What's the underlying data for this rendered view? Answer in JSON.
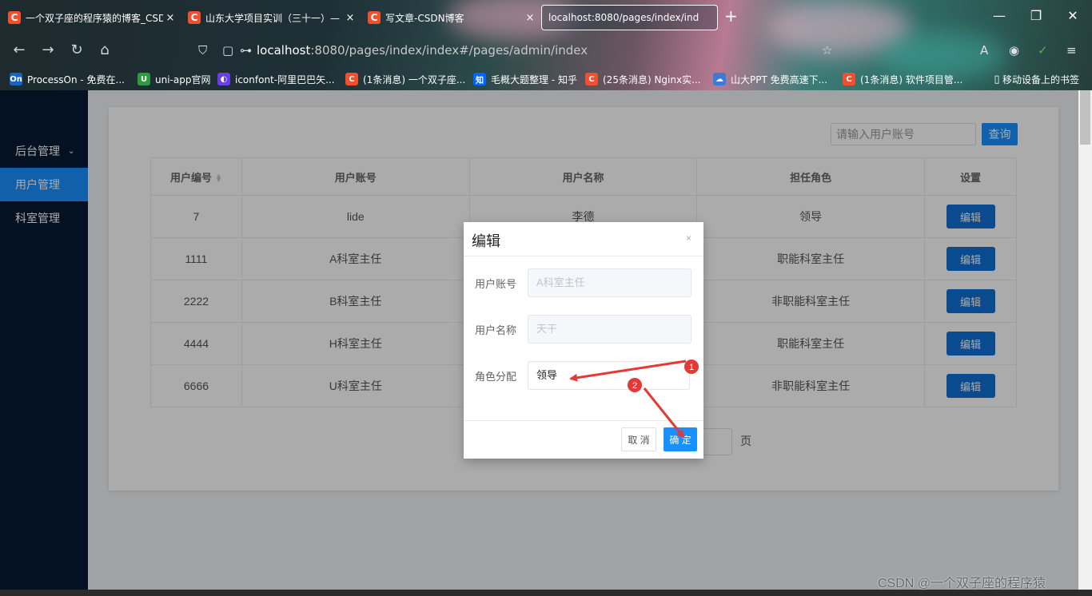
{
  "browser": {
    "tabs": [
      {
        "title": "一个双子座的程序猿的博客_CSD",
        "favicon": "C"
      },
      {
        "title": "山东大学项目实训（三十一）—",
        "favicon": "C"
      },
      {
        "title": "写文章-CSDN博客",
        "favicon": "C"
      },
      {
        "title": "localhost:8080/pages/index/ind"
      }
    ],
    "close_glyph": "×",
    "new_tab": "+",
    "url_host": "localhost",
    "url_rest": ":8080/pages/index/index#/pages/admin/index",
    "bookmarks": [
      {
        "label": "ProcessOn - 免费在...",
        "icon": "On",
        "color": "#1565c0"
      },
      {
        "label": "uni-app官网",
        "icon": "U",
        "color": "#2e9c3e"
      },
      {
        "label": "iconfont-阿里巴巴矢...",
        "icon": "◐",
        "color": "#6a3de8"
      },
      {
        "label": "(1条消息) 一个双子座...",
        "icon": "C",
        "color": "#f1502f"
      },
      {
        "label": "毛概大题整理 - 知乎",
        "icon": "知",
        "color": "#0066ff"
      },
      {
        "label": "(25条消息) Nginx实...",
        "icon": "C",
        "color": "#f1502f"
      },
      {
        "label": "山大PPT 免费高速下...",
        "icon": "☁",
        "color": "#3a7bd5"
      },
      {
        "label": "(1条消息) 软件项目管...",
        "icon": "C",
        "color": "#f1502f"
      },
      {
        "label": "移动设备上的书签",
        "icon": "▯",
        "color": "transparent"
      }
    ]
  },
  "sidebar": {
    "group_label": "后台管理",
    "items": [
      "用户管理",
      "科室管理"
    ]
  },
  "search": {
    "placeholder": "请输入用户账号",
    "button_label": "查询"
  },
  "table": {
    "headers": [
      "用户编号",
      "用户账号",
      "用户名称",
      "担任角色",
      "设置"
    ],
    "rows": [
      {
        "id": "7",
        "account": "lide",
        "name": "李德",
        "role": "领导"
      },
      {
        "id": "1111",
        "account": "A科室主任",
        "name": "",
        "role": "职能科室主任"
      },
      {
        "id": "2222",
        "account": "B科室主任",
        "name": "",
        "role": "非职能科室主任"
      },
      {
        "id": "4444",
        "account": "H科室主任",
        "name": "",
        "role": "职能科室主任"
      },
      {
        "id": "6666",
        "account": "U科室主任",
        "name": "",
        "role": "非职能科室主任"
      }
    ],
    "edit_label": "编辑"
  },
  "pagination": {
    "unit": "页"
  },
  "modal": {
    "title": "编辑",
    "close": "×",
    "account_label": "用户账号",
    "account_value": "A科室主任",
    "name_label": "用户名称",
    "name_value": "天干",
    "role_label": "角色分配",
    "role_value": "领导",
    "cancel_label": "取 消",
    "confirm_label": "确 定"
  },
  "annotations": {
    "step1": "1",
    "step2": "2",
    "color": "#e53935"
  },
  "watermark": "CSDN @一个双子座的程序猿"
}
